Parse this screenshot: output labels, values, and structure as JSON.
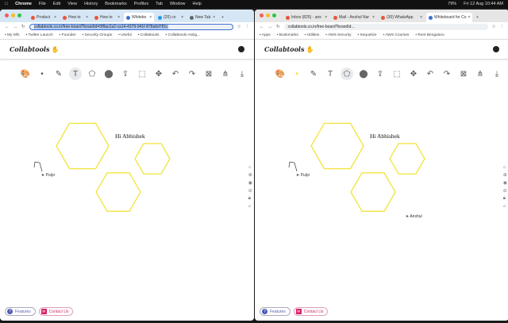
{
  "menubar": {
    "items": [
      "Chrome",
      "File",
      "Edit",
      "View",
      "History",
      "Bookmarks",
      "Profiles",
      "Tab",
      "Window",
      "Help"
    ],
    "battery": "79%",
    "datetime": "Fri 12 Aug 10:44 AM"
  },
  "windows": [
    {
      "tabs": [
        "Product",
        "How to",
        "How to",
        "Whitebo",
        "(20) co",
        "New Tab"
      ],
      "active_tab": 3,
      "url": "collabtools.co.in/free-board?boardId=0f8ac2a2-ca14-4379-941f-878a6d781c",
      "bookmarks": [
        "My Mfs",
        "Twitter Launch",
        "Founder",
        "Security Groups",
        "Useful",
        "Collabtools",
        "Collabtools Assig..."
      ],
      "cursors": [
        {
          "label": "Pulpi"
        }
      ],
      "text": "Hi Abhishek"
    },
    {
      "tabs": [
        "Inbox (825) - ans",
        "Mail - Anshul Nar",
        "(30) WhatsApp",
        "Whiteboard for Co"
      ],
      "active_tab": 3,
      "url": "collabtools.co.in/free-board?boardId...",
      "bookmarks": [
        "Apps",
        "Bookmarks",
        "Utilities",
        "AWS Security",
        "Sequelize",
        "AWS Courses",
        "Rent Bengaluru"
      ],
      "cursors": [
        {
          "label": "Pulpi"
        },
        {
          "label": "Anshul"
        }
      ],
      "text": "Hi Abhishek"
    }
  ],
  "app": {
    "logo": "Collabtools",
    "features": "Features",
    "contact": "Contact Us"
  },
  "toolbar_icons": [
    "palette-icon",
    "brush-size-icon",
    "pencil-icon",
    "text-icon",
    "shapes-icon",
    "delete-icon",
    "upload-icon",
    "select-icon",
    "move-icon",
    "undo-icon",
    "redo-icon",
    "clear-icon",
    "share-icon",
    "download-icon"
  ],
  "colors": {
    "hexagon": "#f2e43a",
    "accent": "#2a5bd7"
  }
}
